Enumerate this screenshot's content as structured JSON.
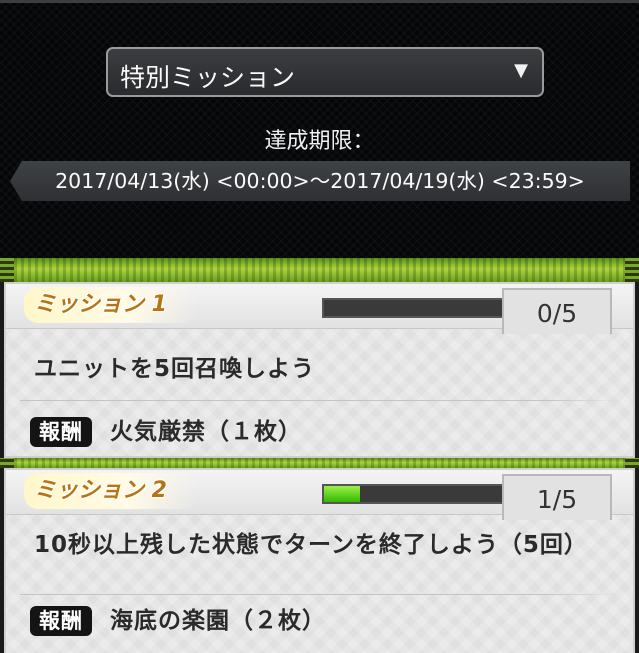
{
  "header": {
    "mission_select": {
      "selected": "特別ミッション",
      "arrow_icon": "triangle-down-icon"
    },
    "deadline_label": "達成期限：",
    "period": "2017/04/13(水) <00:00>～2017/04/19(水) <23:59>"
  },
  "missions": [
    {
      "title": "ミッション 1",
      "progress_text": "0/5",
      "progress_fraction": 0,
      "description": "ユニットを5回召喚しよう",
      "reward_badge": "報酬",
      "reward": "火気厳禁（１枚）"
    },
    {
      "title": "ミッション 2",
      "progress_text": "1/5",
      "progress_fraction": 0.2,
      "description": "10秒以上残した状態でターンを終了しよう（5回）",
      "reward_badge": "報酬",
      "reward": "海底の楽園（２枚）"
    }
  ],
  "colors": {
    "progress_fill": "#33b800",
    "title_gold": "#b87412",
    "header_bg": "#050608",
    "band_green": "#a9d63a"
  }
}
